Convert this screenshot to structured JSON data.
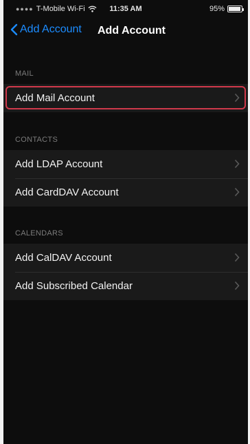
{
  "status_bar": {
    "carrier": "T-Mobile Wi-Fi",
    "time": "11:35 AM",
    "battery": "95%"
  },
  "nav": {
    "back_label": "Add Account",
    "title": "Add Account"
  },
  "sections": {
    "mail": {
      "header": "MAIL",
      "items": [
        "Add Mail Account"
      ]
    },
    "contacts": {
      "header": "CONTACTS",
      "items": [
        "Add LDAP Account",
        "Add CardDAV Account"
      ]
    },
    "calendars": {
      "header": "CALENDARS",
      "items": [
        "Add CalDAV Account",
        "Add Subscribed Calendar"
      ]
    }
  },
  "colors": {
    "accent": "#1c8cff",
    "highlight": "#d0394b",
    "background": "#0d0d0d",
    "cell": "#1a1a1a"
  },
  "icons": {
    "back": "chevron-left-icon",
    "row": "chevron-right-icon",
    "wifi": "wifi-icon"
  }
}
